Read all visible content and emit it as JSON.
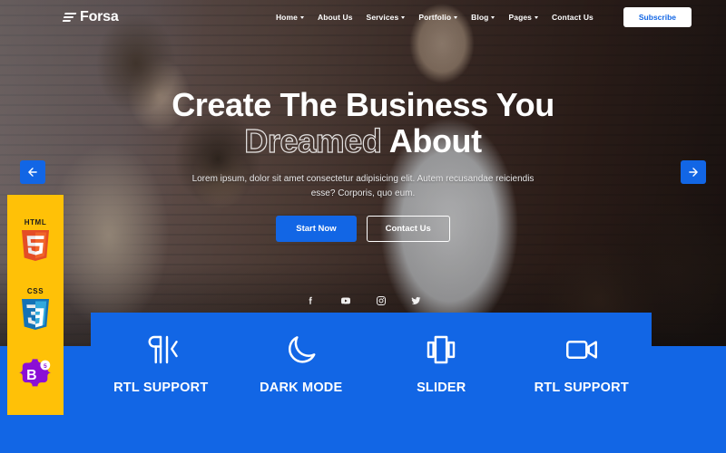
{
  "navbar": {
    "brand": "Forsa",
    "brand_icon": "stacked-bars-icon",
    "menu": [
      {
        "label": "Home",
        "has_caret": true
      },
      {
        "label": "About Us",
        "has_caret": false
      },
      {
        "label": "Services",
        "has_caret": true
      },
      {
        "label": "Portfolio",
        "has_caret": true
      },
      {
        "label": "Blog",
        "has_caret": true
      },
      {
        "label": "Pages",
        "has_caret": true
      },
      {
        "label": "Contact Us",
        "has_caret": false
      }
    ],
    "subscribe_label": "Subscribe",
    "subscribe_text_color": "#1266e5",
    "subscribe_bg_color": "#ffffff"
  },
  "slider": {
    "prev_icon": "arrow-left-icon",
    "next_icon": "arrow-right-icon",
    "arrow_color": "#1266e5"
  },
  "hero": {
    "headline_line1": "Create The Business You",
    "headline_outlined_word": "Dreamed",
    "headline_line2_rest": " About",
    "subtitle": "Lorem ipsum, dolor sit amet consectetur adipisicing elit. Autem recusandae reiciendis esse? Corporis, quo eum.",
    "primary_button": "Start Now",
    "secondary_button": "Contact Us",
    "primary_button_color": "#1266e5"
  },
  "social": [
    {
      "name": "facebook-icon"
    },
    {
      "name": "youtube-icon"
    },
    {
      "name": "instagram-icon"
    },
    {
      "name": "twitter-icon"
    }
  ],
  "features": {
    "background_color": "#1266e5",
    "items": [
      {
        "label": "RTL SUPPORT",
        "icon": "paragraph-rtl-icon"
      },
      {
        "label": "DARK MODE",
        "icon": "moon-icon"
      },
      {
        "label": "SLIDER",
        "icon": "carousel-icon"
      },
      {
        "label": "RTL SUPPORT",
        "icon": "video-camera-icon"
      }
    ]
  },
  "tech_panel": {
    "background_color": "#ffc107",
    "badges": [
      {
        "caption": "HTML",
        "mark": "5",
        "icon": "html5-logo"
      },
      {
        "caption": "CSS",
        "mark": "3",
        "icon": "css3-logo"
      },
      {
        "caption": "",
        "mark": "B",
        "badge_number": "5",
        "icon": "bootstrap5-logo"
      }
    ]
  }
}
